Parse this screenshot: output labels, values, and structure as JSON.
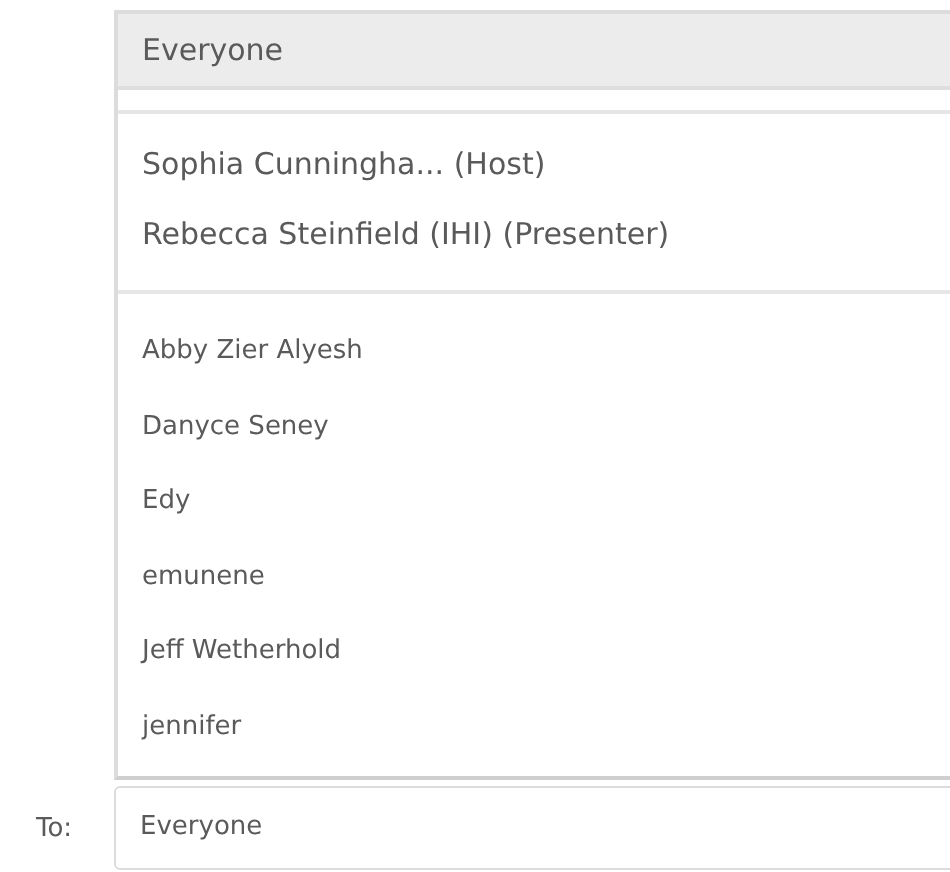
{
  "recipient_dropdown": {
    "sections": [
      {
        "kind": "group",
        "items": [
          {
            "label": "Everyone",
            "selected": true
          }
        ]
      },
      {
        "kind": "role",
        "items": [
          {
            "label": "Sophia Cunningha... (Host)",
            "selected": false
          },
          {
            "label": "Rebecca Steinfield (IHI) (Presenter)",
            "selected": false
          }
        ]
      },
      {
        "kind": "attendee",
        "items": [
          {
            "label": "Abby Zier Alyesh",
            "selected": false
          },
          {
            "label": "Danyce Seney",
            "selected": false
          },
          {
            "label": "Edy",
            "selected": false
          },
          {
            "label": "emunene",
            "selected": false
          },
          {
            "label": "Jeff Wetherhold",
            "selected": false
          },
          {
            "label": "jennifer",
            "selected": false
          }
        ]
      }
    ]
  },
  "to_field": {
    "label": "To:",
    "value": "Everyone"
  }
}
